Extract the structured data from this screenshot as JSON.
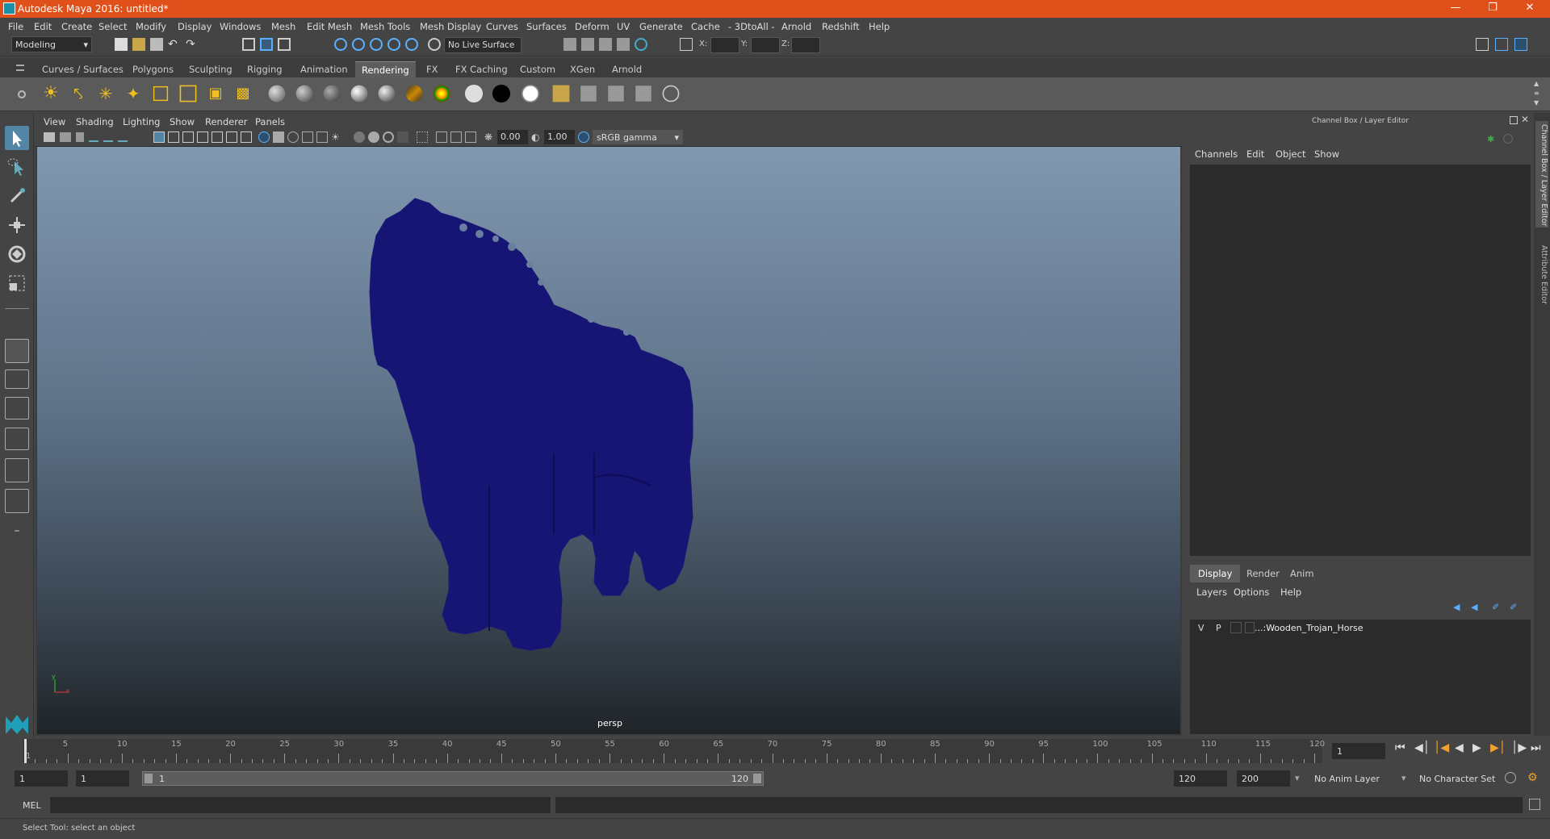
{
  "window": {
    "title": "Autodesk Maya 2016: untitled*"
  },
  "menubar": [
    "File",
    "Edit",
    "Create",
    "Select",
    "Modify",
    "Display",
    "Windows",
    "Mesh",
    "Edit Mesh",
    "Mesh Tools",
    "Mesh Display",
    "Curves",
    "Surfaces",
    "Deform",
    "UV",
    "Generate",
    "Cache",
    "- 3DtoAll -",
    "Arnold",
    "Redshift",
    "Help"
  ],
  "statusline": {
    "mode": "Modeling",
    "live_surface": "No Live Surface",
    "x_label": "X:",
    "y_label": "Y:",
    "z_label": "Z:"
  },
  "shelf_tabs": [
    "Curves / Surfaces",
    "Polygons",
    "Sculpting",
    "Rigging",
    "Animation",
    "Rendering",
    "FX",
    "FX Caching",
    "Custom",
    "XGen",
    "Arnold"
  ],
  "shelf_active": "Rendering",
  "panel_menu": [
    "View",
    "Shading",
    "Lighting",
    "Show",
    "Renderer",
    "Panels"
  ],
  "panel_tools": {
    "exposure": "0.00",
    "gamma": "1.00",
    "colorspace": "sRGB gamma"
  },
  "viewport": {
    "camera": "persp",
    "axis_y": "y",
    "axis_x": "x"
  },
  "channelbox": {
    "title": "Channel Box / Layer Editor",
    "menu": [
      "Channels",
      "Edit",
      "Object",
      "Show"
    ]
  },
  "layer_editor": {
    "tabs": [
      "Display",
      "Render",
      "Anim"
    ],
    "active": "Display",
    "menu": [
      "Layers",
      "Options",
      "Help"
    ],
    "layers": [
      {
        "v": "V",
        "p": "P",
        "name": "...:Wooden_Trojan_Horse"
      }
    ]
  },
  "side_tabs": [
    "Channel Box / Layer Editor",
    "Attribute Editor"
  ],
  "timeline": {
    "ticks": [
      "1",
      "5",
      "10",
      "15",
      "20",
      "25",
      "30",
      "35",
      "40",
      "45",
      "50",
      "55",
      "60",
      "65",
      "70",
      "75",
      "80",
      "85",
      "90",
      "95",
      "100",
      "105",
      "110",
      "115",
      "120"
    ],
    "current_frame": "1"
  },
  "range": {
    "start": "1",
    "playback_start": "1",
    "slider_start": "1",
    "slider_end": "120",
    "playback_end": "120",
    "end": "200",
    "anim_layer": "No Anim Layer",
    "char_set": "No Character Set"
  },
  "cmdline": {
    "label": "MEL"
  },
  "helpline": "Select Tool: select an object"
}
